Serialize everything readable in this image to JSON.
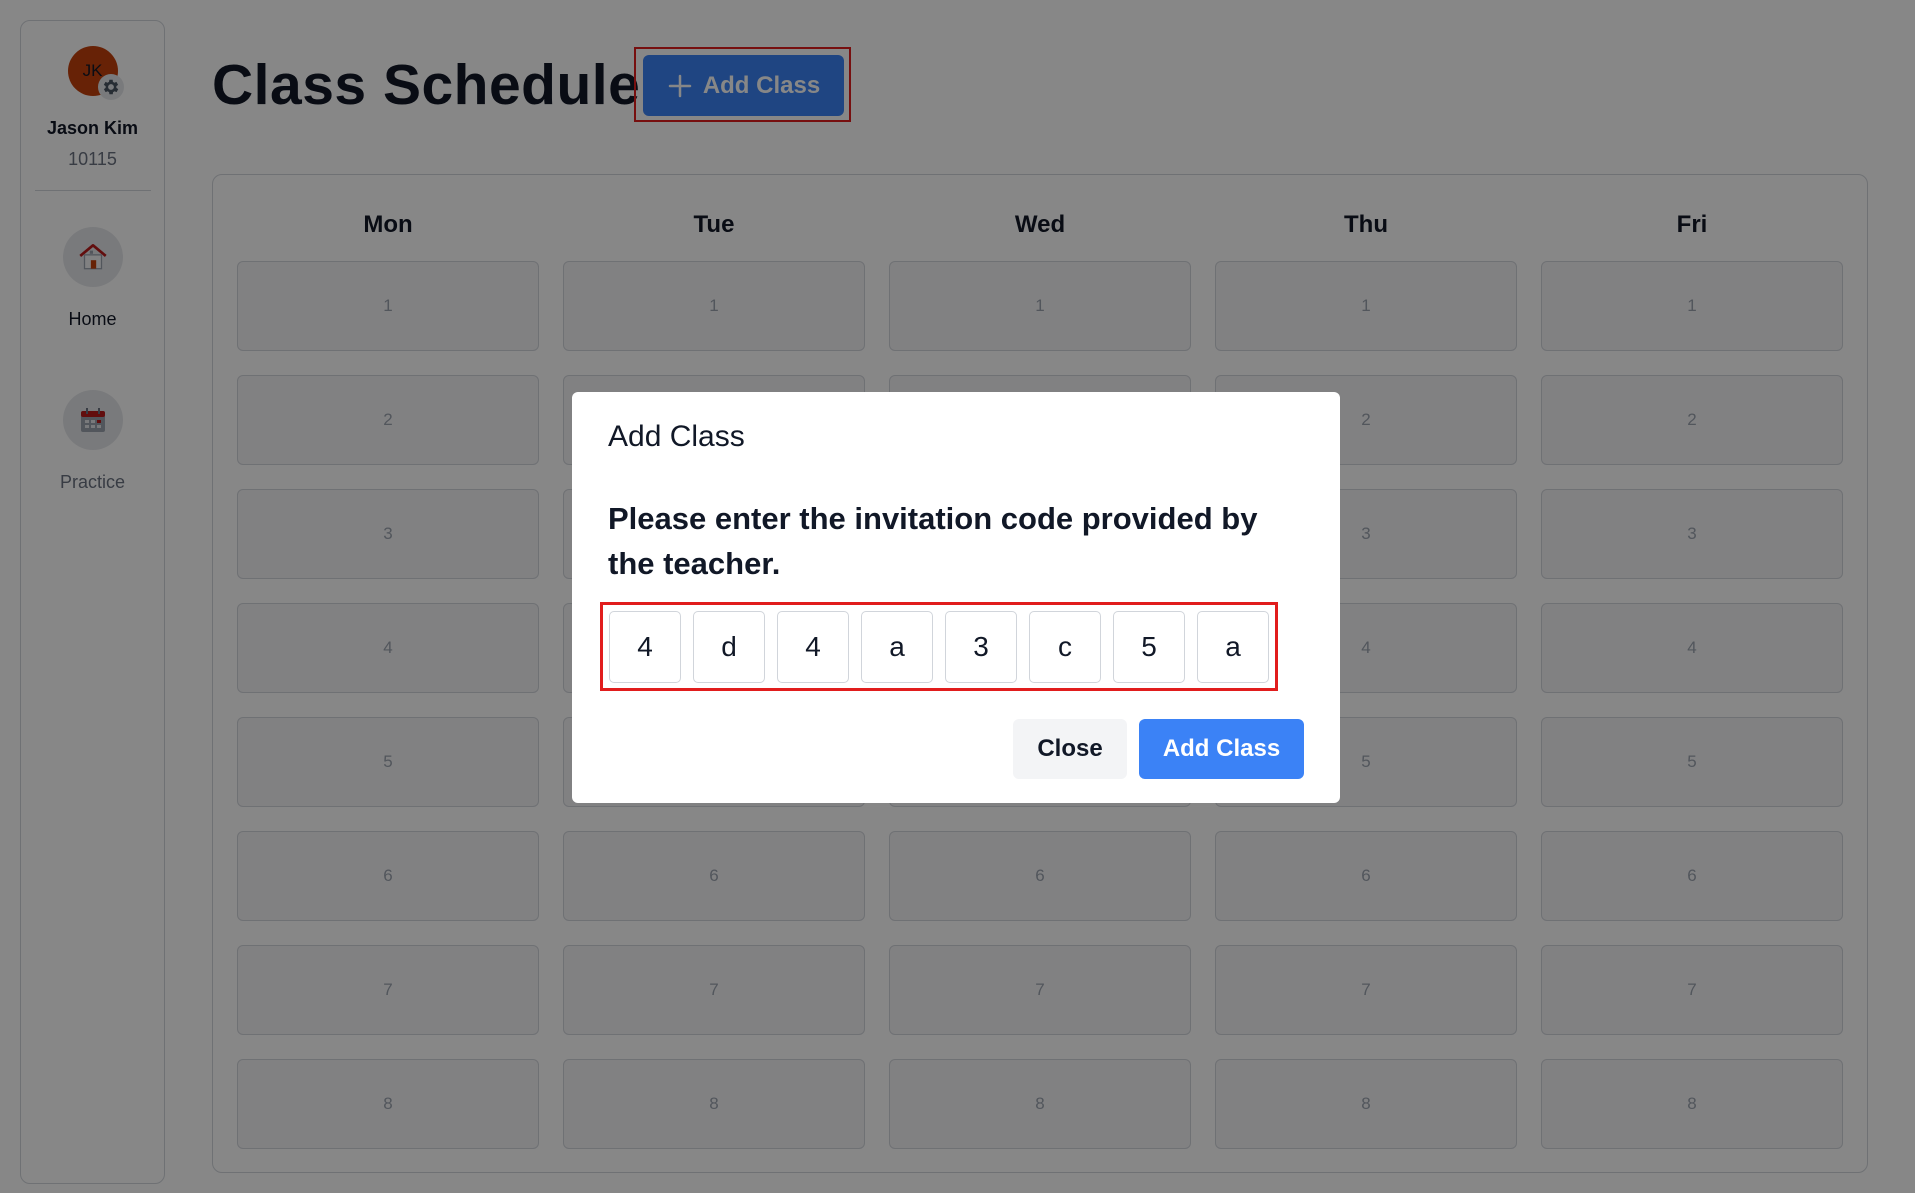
{
  "sidebar": {
    "avatar_initials": "JK",
    "user_name": "Jason Kim",
    "user_id": "10115",
    "items": [
      {
        "label": "Home",
        "icon": "home-icon"
      },
      {
        "label": "Practice",
        "icon": "calendar-icon"
      }
    ]
  },
  "header": {
    "title": "Class Schedule",
    "add_button_label": "Add Class"
  },
  "schedule": {
    "days": [
      "Mon",
      "Tue",
      "Wed",
      "Thu",
      "Fri"
    ],
    "periods": [
      "1",
      "2",
      "3",
      "4",
      "5",
      "6",
      "7",
      "8"
    ]
  },
  "modal": {
    "title": "Add Class",
    "prompt": "Please enter the invitation code provided by the teacher.",
    "code": [
      "4",
      "d",
      "4",
      "a",
      "3",
      "c",
      "5",
      "a"
    ],
    "close_label": "Close",
    "add_label": "Add Class"
  },
  "colors": {
    "primary": "#3b82f6",
    "highlight": "#e11d1d",
    "avatar": "#c2410c"
  }
}
